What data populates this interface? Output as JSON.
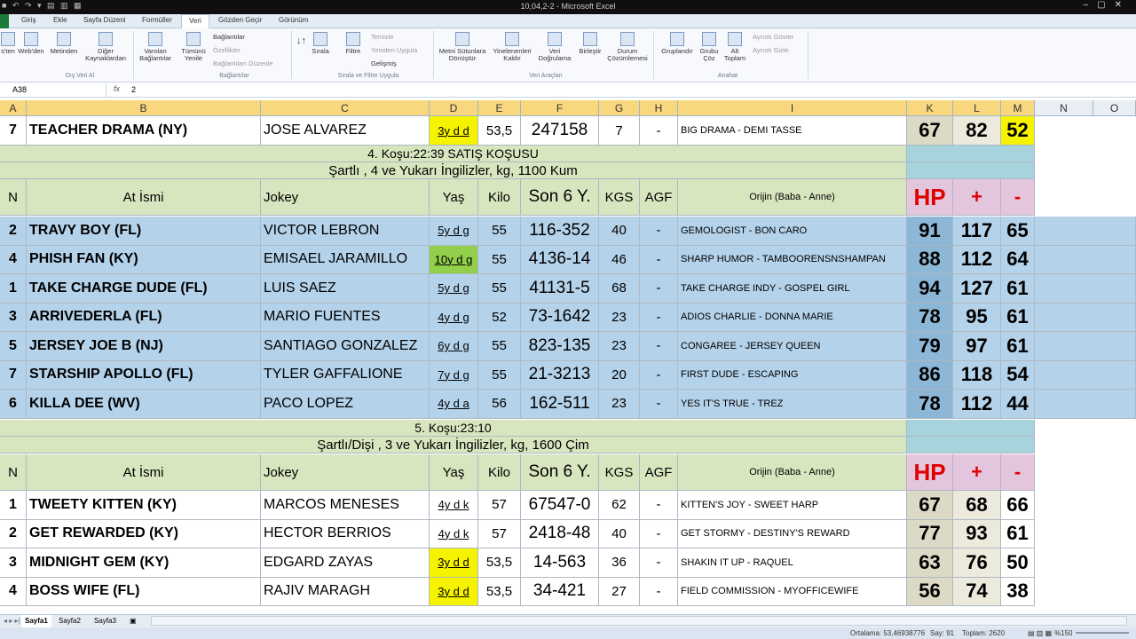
{
  "window": {
    "title": "10,04,2-2 - Microsoft Excel"
  },
  "tabs": [
    "Giriş",
    "Ekle",
    "Sayfa Düzeni",
    "Formüller",
    "Veri",
    "Gözden Geçir",
    "Görünüm"
  ],
  "ribbon": {
    "buttons": [
      "s'ten",
      "Web'den",
      "Metinden",
      "Diğer Kaynaklardan",
      "Varolan Bağlantılar",
      "Tümünü Yenile",
      "Sırala",
      "Filtre",
      "Metni Sütunlara Dönüştür",
      "Yinelenenleri Kaldır",
      "Veri Doğrulama",
      "Birleştir",
      "Durum Çözümlemesi",
      "Gruplandır",
      "Grubu Çöz",
      "Alt Toplam"
    ],
    "small": [
      "Bağlantılar",
      "Özellikler",
      "Bağlantıları Düzenle",
      "Temizle",
      "Yeniden Uygula",
      "Gelişmiş",
      "Ayrıntı Göster",
      "Ayrıntı Gizle"
    ],
    "groups": [
      "Dış Veri Al",
      "Bağlantılar",
      "Sırala ve Filtre Uygula",
      "Veri Araçları",
      "Anahat"
    ]
  },
  "formula_bar": {
    "name_box": "A38",
    "fx": "fx",
    "value": "2"
  },
  "columns": [
    "A",
    "B",
    "C",
    "D",
    "E",
    "F",
    "G",
    "H",
    "I",
    "K",
    "L",
    "M",
    "N",
    "O"
  ],
  "top_row": {
    "no": "7",
    "name": "TEACHER DRAMA (NY)",
    "jockey": "JOSE ALVAREZ",
    "age": "3y d d",
    "kilo": "53,5",
    "last6": "247158",
    "kgs": "7",
    "agf": "-",
    "origin": "BIG DRAMA - DEMI TASSE",
    "hp": "67",
    "plus": "82",
    "minus": "52"
  },
  "race4": {
    "title": "4. Koşu:22:39 SATIŞ KOŞUSU",
    "conditions": "Şartlı , 4 ve Yukarı İngilizler, kg, 1100 Kum",
    "header": {
      "n": "N",
      "name": "At İsmi",
      "jockey": "Jokey",
      "age": "Yaş",
      "kilo": "Kilo",
      "last6": "Son 6 Y.",
      "kgs": "KGS",
      "agf": "AGF",
      "origin": "Orijin (Baba - Anne)",
      "hp": "HP",
      "plus": "+",
      "minus": "-"
    },
    "rows": [
      {
        "no": "2",
        "name": "TRAVY BOY (FL)",
        "jockey": "VICTOR LEBRON",
        "age": "5y d g",
        "kilo": "55",
        "last6": "116-352",
        "kgs": "40",
        "agf": "-",
        "origin": "GEMOLOGIST - BON CARO",
        "hp": "91",
        "plus": "117",
        "minus": "65"
      },
      {
        "no": "4",
        "name": "PHISH FAN (KY)",
        "jockey": "EMISAEL JARAMILLO",
        "age": "10y d g",
        "kilo": "55",
        "last6": "4136-14",
        "kgs": "46",
        "agf": "-",
        "origin": "SHARP HUMOR - TAMBOORENSNSHAMPAN",
        "hp": "88",
        "plus": "112",
        "minus": "64"
      },
      {
        "no": "1",
        "name": "TAKE CHARGE DUDE (FL)",
        "jockey": "LUIS SAEZ",
        "age": "5y d g",
        "kilo": "55",
        "last6": "41131-5",
        "kgs": "68",
        "agf": "-",
        "origin": "TAKE CHARGE INDY - GOSPEL GIRL",
        "hp": "94",
        "plus": "127",
        "minus": "61"
      },
      {
        "no": "3",
        "name": "ARRIVEDERLA (FL)",
        "jockey": "MARIO FUENTES",
        "age": "4y d g",
        "kilo": "52",
        "last6": "73-1642",
        "kgs": "23",
        "agf": "-",
        "origin": "ADIOS CHARLIE - DONNA MARIE",
        "hp": "78",
        "plus": "95",
        "minus": "61"
      },
      {
        "no": "5",
        "name": "JERSEY JOE B (NJ)",
        "jockey": "SANTIAGO GONZALEZ",
        "age": "6y d g",
        "kilo": "55",
        "last6": "823-135",
        "kgs": "23",
        "agf": "-",
        "origin": "CONGAREE - JERSEY QUEEN",
        "hp": "79",
        "plus": "97",
        "minus": "61"
      },
      {
        "no": "7",
        "name": "STARSHIP APOLLO (FL)",
        "jockey": "TYLER GAFFALIONE",
        "age": "7y d g",
        "kilo": "55",
        "last6": "21-3213",
        "kgs": "20",
        "agf": "-",
        "origin": "FIRST DUDE - ESCAPING",
        "hp": "86",
        "plus": "118",
        "minus": "54"
      },
      {
        "no": "6",
        "name": "KILLA DEE (WV)",
        "jockey": "PACO LOPEZ",
        "age": "4y d a",
        "kilo": "56",
        "last6": "162-511",
        "kgs": "23",
        "agf": "-",
        "origin": "YES IT'S TRUE - TREZ",
        "hp": "78",
        "plus": "112",
        "minus": "44"
      }
    ]
  },
  "race5": {
    "title": "5. Koşu:23:10",
    "conditions": "Şartlı/Dişi , 3 ve Yukarı İngilizler, kg, 1600 Çim",
    "header": {
      "n": "N",
      "name": "At İsmi",
      "jockey": "Jokey",
      "age": "Yaş",
      "kilo": "Kilo",
      "last6": "Son 6 Y.",
      "kgs": "KGS",
      "agf": "AGF",
      "origin": "Orijin (Baba - Anne)",
      "hp": "HP",
      "plus": "+",
      "minus": "-"
    },
    "rows": [
      {
        "no": "1",
        "name": "TWEETY KITTEN (KY)",
        "jockey": "MARCOS MENESES",
        "age": "4y d k",
        "kilo": "57",
        "last6": "67547-0",
        "kgs": "62",
        "agf": "-",
        "origin": "KITTEN'S JOY - SWEET HARP",
        "hp": "67",
        "plus": "68",
        "minus": "66"
      },
      {
        "no": "2",
        "name": "GET REWARDED (KY)",
        "jockey": "HECTOR BERRIOS",
        "age": "4y d k",
        "kilo": "57",
        "last6": "2418-48",
        "kgs": "40",
        "agf": "-",
        "origin": "GET STORMY - DESTINY'S REWARD",
        "hp": "77",
        "plus": "93",
        "minus": "61"
      },
      {
        "no": "3",
        "name": "MIDNIGHT GEM (KY)",
        "jockey": "EDGARD ZAYAS",
        "age": "3y d d",
        "kilo": "53,5",
        "last6": "14-563",
        "kgs": "36",
        "agf": "-",
        "origin": "SHAKIN IT UP - RAQUEL",
        "hp": "63",
        "plus": "76",
        "minus": "50"
      },
      {
        "no": "4",
        "name": "BOSS WIFE (FL)",
        "jockey": "RAJIV MARAGH",
        "age": "3y d d",
        "kilo": "53,5",
        "last6": "34-421",
        "kgs": "27",
        "agf": "-",
        "origin": "FIELD COMMISSION - MYOFFICEWIFE",
        "hp": "56",
        "plus": "74",
        "minus": "38"
      }
    ]
  },
  "sheets": [
    "Sayfa1",
    "Sayfa2",
    "Sayfa3"
  ],
  "status": {
    "avg": "Ortalama: 53,46938776",
    "count": "Say: 91",
    "sum": "Toplam: 2620",
    "zoom": "%150"
  }
}
